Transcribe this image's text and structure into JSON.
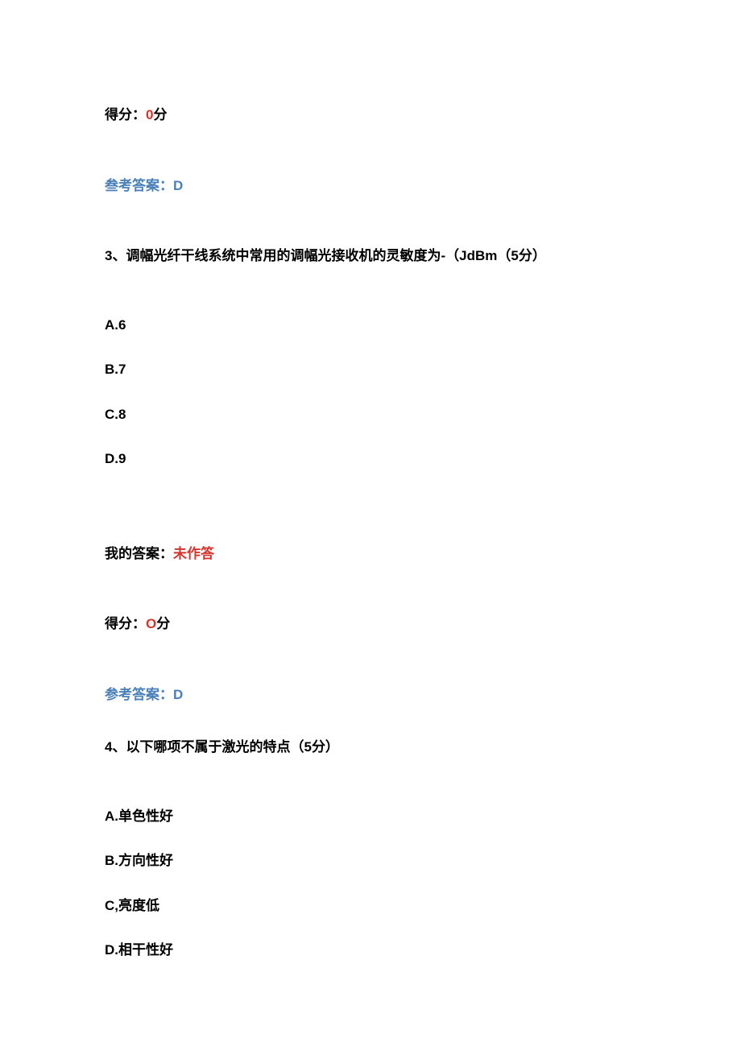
{
  "q2_tail": {
    "score_prefix": "得分：",
    "score_value": "0",
    "score_suffix": "分",
    "ref_prefix": "叁考答案：",
    "ref_value": "D"
  },
  "q3": {
    "number": "3",
    "sep": "、",
    "prompt": "调幅光纤干线系统中常用的调幅光接收机的灵敏度为-（",
    "unit": "JdBm",
    "points_prefix": "（",
    "points_value": "5",
    "points_suffix": "分）",
    "options": [
      {
        "label": "A.",
        "text": "6"
      },
      {
        "label": "B.",
        "text": "7"
      },
      {
        "label": "C.",
        "text": "8"
      },
      {
        "label": "D.",
        "text": "9"
      }
    ],
    "my_prefix": "我的答案：",
    "my_value": "未作答",
    "score_prefix": "得分：",
    "score_value": "O",
    "score_suffix": "分",
    "ref_prefix": "参考答案：",
    "ref_value": "D"
  },
  "q4": {
    "number": "4",
    "sep": "、",
    "prompt": "以下哪项不属于激光的特点（",
    "points_value": "5",
    "points_suffix": "分）",
    "options": [
      {
        "label": "A.",
        "text": "单色性好"
      },
      {
        "label": "B",
        "sep2": ".",
        "text": "方向性好"
      },
      {
        "label": "C,",
        "text": "亮度低"
      },
      {
        "label": "D.",
        "text": "相干性好"
      }
    ]
  }
}
